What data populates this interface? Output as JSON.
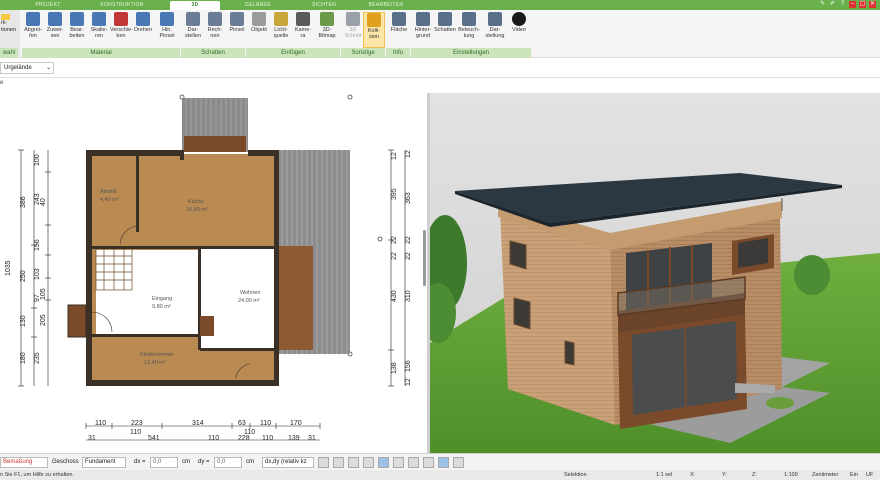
{
  "tabs": [
    {
      "label": "Projekt",
      "active": false
    },
    {
      "label": "Konstruktion",
      "active": false
    },
    {
      "label": "3D",
      "active": true
    },
    {
      "label": "Gelände",
      "active": false
    },
    {
      "label": "Sichten",
      "active": false
    },
    {
      "label": "Bearbeiten",
      "active": false
    }
  ],
  "left_cut": {
    "top": "rk·",
    "mid": "tionen",
    "group": "wahl"
  },
  "ribbon_buttons": [
    {
      "label": "Abgrei-\nfen",
      "icon": "eyedropper-icon"
    },
    {
      "label": "Zuwei-\nsen",
      "icon": "assign-icon"
    },
    {
      "label": "Bear-\nbeiten",
      "icon": "edit-icon"
    },
    {
      "label": "Skalie-\nren",
      "icon": "scale-icon"
    },
    {
      "label": "Verschie-\nben",
      "icon": "move-icon"
    },
    {
      "label": "Drehen",
      "icon": "rotate-icon"
    },
    {
      "label": "Hin.\nPinsel",
      "icon": "brush-icon"
    },
    {
      "label": "Dar-\nstellen",
      "icon": "shadow-display-icon"
    },
    {
      "label": "Rech-\nnen",
      "icon": "shadow-calc-icon"
    },
    {
      "label": "Pinsel",
      "icon": "shadow-brush-icon"
    },
    {
      "label": "Objekt",
      "icon": "object-icon"
    },
    {
      "label": "Licht-\nquelle",
      "icon": "light-icon"
    },
    {
      "label": "Kame-\nra",
      "icon": "camera-icon"
    },
    {
      "label": "3D-\nBitmap",
      "icon": "bitmap-icon"
    },
    {
      "label": "3D\nSchnitt",
      "icon": "section-icon"
    },
    {
      "label": "Kolli-\nsion",
      "icon": "collision-icon"
    },
    {
      "label": "Fläche",
      "icon": "area-icon"
    },
    {
      "label": "Hinter-\ngrund",
      "icon": "background-icon"
    },
    {
      "label": "Schatten",
      "icon": "house-shadow-icon"
    },
    {
      "label": "Beleuch-\ntung",
      "icon": "lighting-icon"
    },
    {
      "label": "Dar-\nstellung",
      "icon": "display-icon"
    },
    {
      "label": "Video",
      "icon": "video-icon"
    }
  ],
  "ribbon_groups": [
    "Material",
    "Schatten",
    "Einfügen",
    "Sonstige",
    "Info",
    "Einstellungen"
  ],
  "layer_dropdown": "Urgelände",
  "row_label": "e",
  "plan": {
    "rooms": [
      {
        "name": "Abstell",
        "sub": "4,40 m²"
      },
      {
        "name": "Küche",
        "sub": "16,80 m²"
      },
      {
        "name": "Eingang",
        "sub": "9,80 m²"
      },
      {
        "name": "Wohnen",
        "sub": "24,00 m²"
      },
      {
        "name": "Kinderzimmer",
        "sub": "12,40 m²"
      }
    ],
    "left_dims_outer": [
      "1035"
    ],
    "left_dims_mid": [
      "386",
      "250",
      "130",
      "180"
    ],
    "left_dims_inner": [
      "100",
      "243",
      "40",
      "156",
      "103",
      "97",
      "105",
      "205",
      "235"
    ],
    "right_dims_outer": [
      "395",
      "430",
      "138"
    ],
    "right_dims_inner": [
      "363",
      "310",
      "156"
    ],
    "right_dims_small": [
      "12",
      "22",
      "22",
      "22",
      "22",
      "12",
      "12"
    ],
    "bottom_row1": [
      "110",
      "223",
      "314",
      "63",
      "110",
      "170"
    ],
    "bottom_row2": [
      "110",
      "110"
    ],
    "bottom_row3": [
      "110",
      "228",
      "110"
    ],
    "bottom_row4": [
      "31",
      "541",
      "31",
      "139",
      "31"
    ]
  },
  "bottom_bar": {
    "measure": "Bemaßung",
    "floor_label": "Geschoss",
    "floor_value": "Fundament",
    "dx_label": "dx =",
    "dx_value": "0,0",
    "dx_unit": "cm",
    "dy_label": "dy =",
    "dy_value": "0,0",
    "dy_unit": "cm",
    "mode": "dx,dy (relativ kz"
  },
  "status_bar": {
    "help": "n Sie F1, um Hilfe zu erhalten.",
    "selection": "Selektion",
    "scale_sel": "1:1 sel",
    "x": "X:",
    "y": "Y:",
    "z": "Z:",
    "scale": "1:100",
    "unit": "Zentimeter",
    "ein": "Ein",
    "uf": "UF"
  },
  "colors": {
    "tab_green": "#6ab04c",
    "group_green": "#cbe4bc",
    "floor_wood": "#b98a52",
    "wall": "#3b3026",
    "roof": "#2b3842",
    "siding": "#c79f74",
    "grass": "#5e9e35"
  }
}
